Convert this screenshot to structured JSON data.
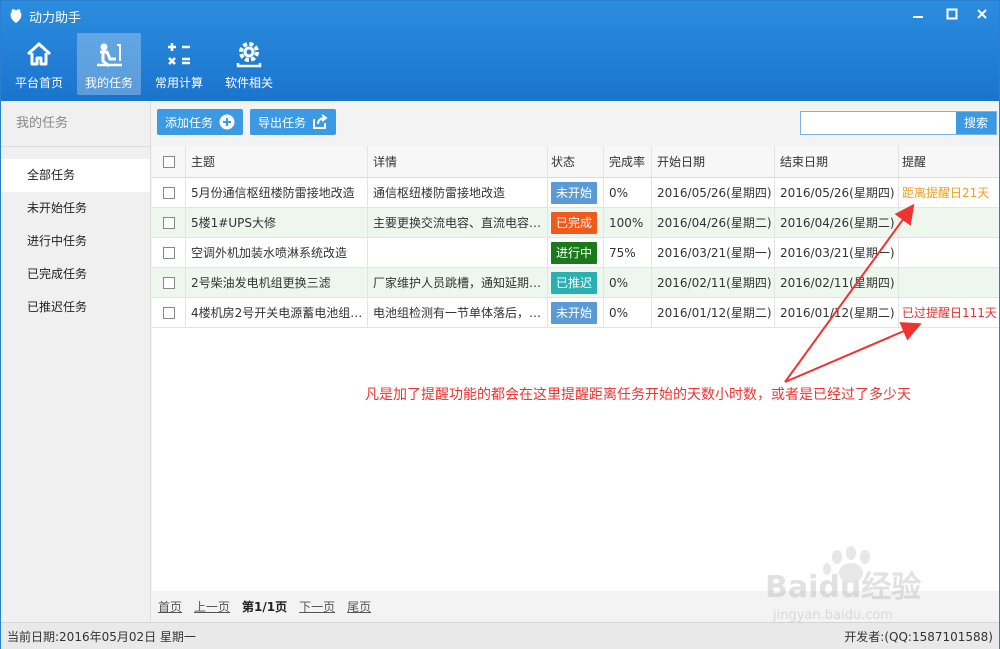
{
  "window": {
    "title": "动力助手",
    "minimize_label": "—",
    "maximize_label": "☐",
    "close_label": "✕"
  },
  "toolbar": [
    {
      "label": "平台首页",
      "icon": "home-icon"
    },
    {
      "label": "我的任务",
      "icon": "task-icon"
    },
    {
      "label": "常用计算",
      "icon": "calculator-icon"
    },
    {
      "label": "软件相关",
      "icon": "gear-icon"
    }
  ],
  "sidebar": {
    "title": "我的任务",
    "items": [
      "全部任务",
      "未开始任务",
      "进行中任务",
      "已完成任务",
      "已推迟任务"
    ]
  },
  "actions": {
    "add_label": "添加任务",
    "export_label": "导出任务"
  },
  "search": {
    "value": "",
    "placeholder": "",
    "button_label": "搜索"
  },
  "table": {
    "columns": [
      "主题",
      "详情",
      "状态",
      "完成率",
      "开始日期",
      "结束日期",
      "提醒"
    ],
    "rows": [
      {
        "subject": "5月份通信枢纽楼防雷接地改造",
        "detail": "通信枢纽楼防雷接地改造",
        "status": "未开始",
        "rate": "0%",
        "start": "2016/05/26(星期四)",
        "end": "2016/05/26(星期四)",
        "reminder": "距离提醒日21天"
      },
      {
        "subject": "5楼1#UPS大修",
        "detail": "主要更换交流电容、直流电容…",
        "status": "已完成",
        "rate": "100%",
        "start": "2016/04/26(星期二)",
        "end": "2016/04/26(星期二)",
        "reminder": ""
      },
      {
        "subject": "空调外机加装水喷淋系统改造",
        "detail": "",
        "status": "进行中",
        "rate": "75%",
        "start": "2016/03/21(星期一)",
        "end": "2016/03/21(星期一)",
        "reminder": ""
      },
      {
        "subject": "2号柴油发电机组更换三滤",
        "detail": "厂家维护人员跳槽，通知延期…",
        "status": "已推迟",
        "rate": "0%",
        "start": "2016/02/11(星期四)",
        "end": "2016/02/11(星期四)",
        "reminder": ""
      },
      {
        "subject": "4楼机房2号开关电源蓄电池组…",
        "detail": "电池组检测有一节单体落后，…",
        "status": "未开始",
        "rate": "0%",
        "start": "2016/01/12(星期二)",
        "end": "2016/01/12(星期二)",
        "reminder": "已过提醒日111天"
      }
    ]
  },
  "status_colors": {
    "未开始": "#5b9bd5",
    "已完成": "#f05a1a",
    "进行中": "#1a7a1a",
    "已推迟": "#2ab0b0"
  },
  "reminder_colors": {
    "upcoming": "#f0a020",
    "overdue": "#e33333"
  },
  "pager": {
    "first": "首页",
    "prev": "上一页",
    "current": "第1/1页",
    "next": "下一页",
    "last": "尾页"
  },
  "statusbar": {
    "date": "当前日期:2016年05月02日 星期一",
    "developer": "开发者:(QQ:1587101588)"
  },
  "annotation": {
    "note": "凡是加了提醒功能的都会在这里提醒距离任务开始的天数小时数，或者是已经过了多少天"
  },
  "watermark": {
    "text": "Baidu经验",
    "url": "jingyan.baidu.com"
  },
  "colors": {
    "titlebar": "#1f80d6",
    "accent": "#3b9ae1"
  }
}
